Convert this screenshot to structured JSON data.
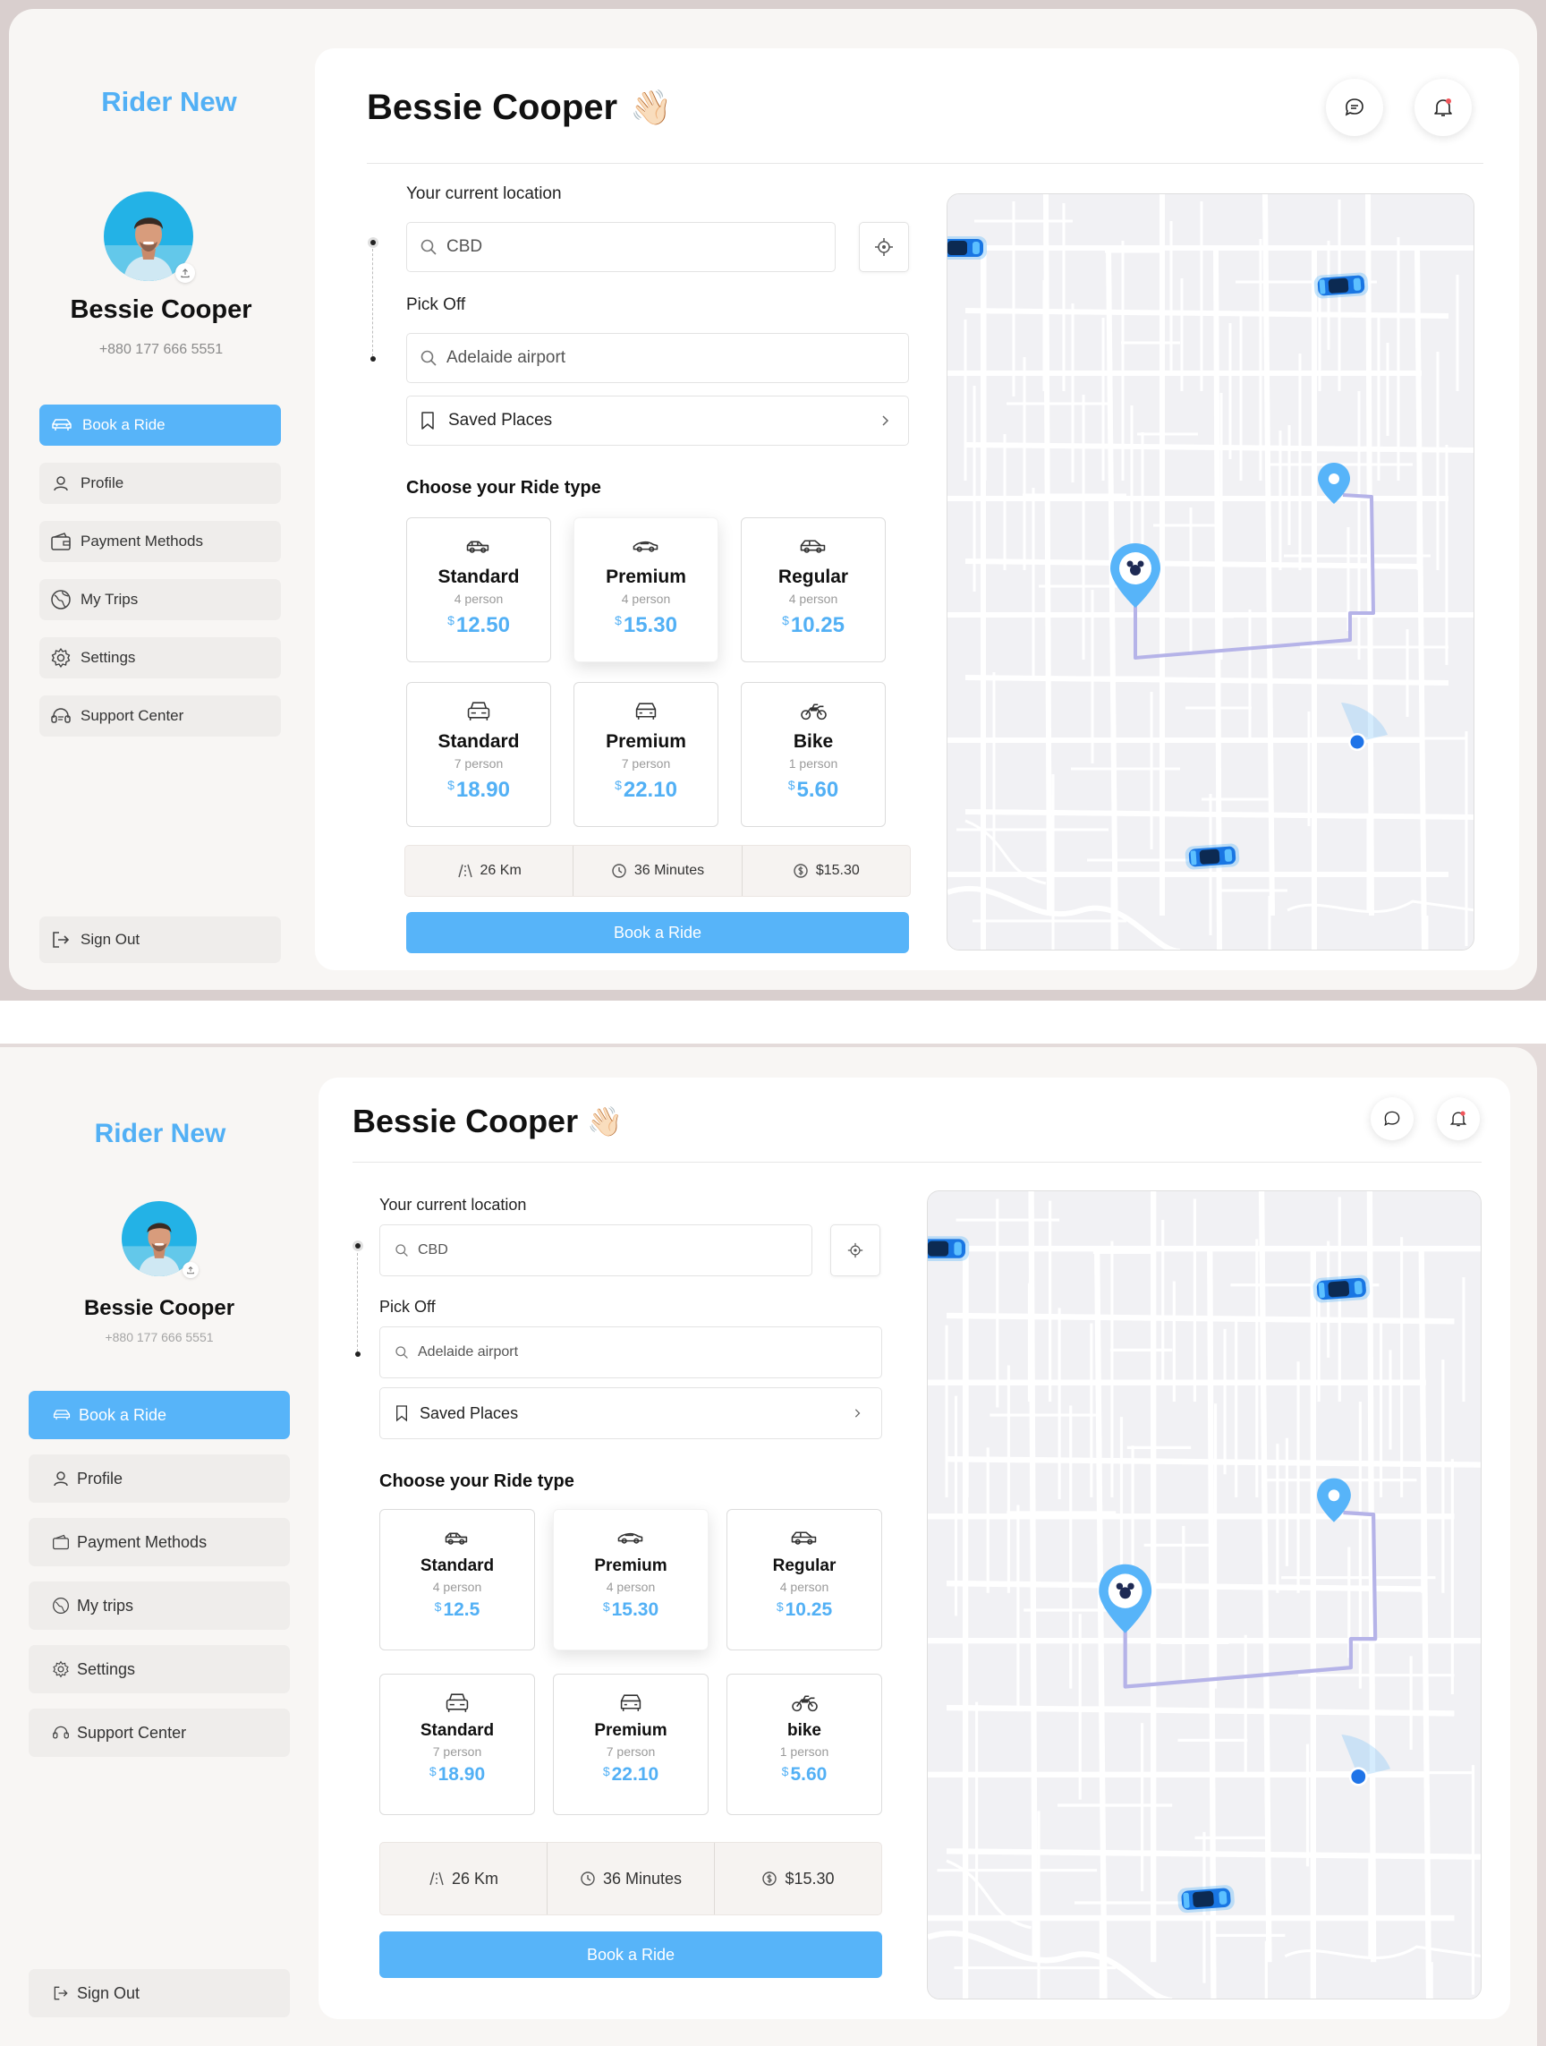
{
  "colors": {
    "accent": "#57B4F9",
    "price": "#52B0F5",
    "sidebar_bg": "#F8F6F4",
    "main_bg": "#FFFFFF",
    "route": "#B5B3E8"
  },
  "screens": [
    {
      "brand": "Rider New",
      "user": {
        "name": "Bessie Cooper",
        "phone": "+880 177 666 5551"
      },
      "nav": [
        {
          "label": "Book a Ride",
          "icon": "car-icon",
          "active": true
        },
        {
          "label": "Profile",
          "icon": "user-icon"
        },
        {
          "label": "Payment Methods",
          "icon": "wallet-icon"
        },
        {
          "label": "My Trips",
          "icon": "globe-icon"
        },
        {
          "label": "Settings",
          "icon": "gear-icon"
        },
        {
          "label": "Support Center",
          "icon": "headset-icon"
        }
      ],
      "signout": "Sign Out",
      "title": "Bessie Cooper",
      "wave": "👋🏻",
      "current_label": "Your current location",
      "current_value": "CBD",
      "pickoff_label": "Pick Off",
      "pickoff_value": "Adelaide airport",
      "saved_places": "Saved Places",
      "ride_title": "Choose your Ride type",
      "rides": [
        {
          "name": "Standard",
          "cap": "4 person",
          "currency": "$",
          "price": "12.50",
          "icon": "sedan-icon"
        },
        {
          "name": "Premium",
          "cap": "4 person",
          "currency": "$",
          "price": "15.30",
          "icon": "sports-car-icon",
          "selected": true
        },
        {
          "name": "Regular",
          "cap": "4 person",
          "currency": "$",
          "price": "10.25",
          "icon": "hatchback-icon"
        },
        {
          "name": "Standard",
          "cap": "7 person",
          "currency": "$",
          "price": "18.90",
          "icon": "van-icon"
        },
        {
          "name": "Premium",
          "cap": "7 person",
          "currency": "$",
          "price": "22.10",
          "icon": "suv-icon"
        },
        {
          "name": "Bike",
          "cap": "1 person",
          "currency": "$",
          "price": "5.60",
          "icon": "motorbike-icon"
        }
      ],
      "summary": {
        "distance": "26 Km",
        "duration": "36 Minutes",
        "fare": "$15.30"
      },
      "book_button": "Book a Ride"
    },
    {
      "brand": "Rider New",
      "user": {
        "name": "Bessie Cooper",
        "phone": "+880 177 666 5551"
      },
      "nav": [
        {
          "label": "Book a Ride",
          "icon": "car-icon",
          "active": true
        },
        {
          "label": "Profile",
          "icon": "user-icon"
        },
        {
          "label": "Payment Methods",
          "icon": "wallet-icon"
        },
        {
          "label": "My trips",
          "icon": "globe-icon"
        },
        {
          "label": "Settings",
          "icon": "gear-icon"
        },
        {
          "label": "Support Center",
          "icon": "headset-icon"
        }
      ],
      "signout": "Sign Out",
      "title": "Bessie Cooper",
      "wave": "👋🏻",
      "current_label": "Your current location",
      "current_value": "CBD",
      "pickoff_label": "Pick Off",
      "pickoff_value": "Adelaide airport",
      "saved_places": "Saved Places",
      "ride_title": "Choose your Ride type",
      "rides": [
        {
          "name": "Standard",
          "cap": "4 person",
          "currency": "$",
          "price": "12.5",
          "icon": "sedan-icon"
        },
        {
          "name": "Premium",
          "cap": "4 person",
          "currency": "$",
          "price": "15.30",
          "icon": "sports-car-icon",
          "selected": true
        },
        {
          "name": "Regular",
          "cap": "4 person",
          "currency": "$",
          "price": "10.25",
          "icon": "hatchback-icon"
        },
        {
          "name": "Standard",
          "cap": "7 person",
          "currency": "$",
          "price": "18.90",
          "icon": "van-icon"
        },
        {
          "name": "Premium",
          "cap": "7 person",
          "currency": "$",
          "price": "22.10",
          "icon": "suv-icon"
        },
        {
          "name": "bike",
          "cap": "1 person",
          "currency": "$",
          "price": "5.60",
          "icon": "motorbike-icon"
        }
      ],
      "summary": {
        "distance": "26 Km",
        "duration": "36 Minutes",
        "fare": "$15.30"
      },
      "book_button": "Book a Ride"
    }
  ]
}
